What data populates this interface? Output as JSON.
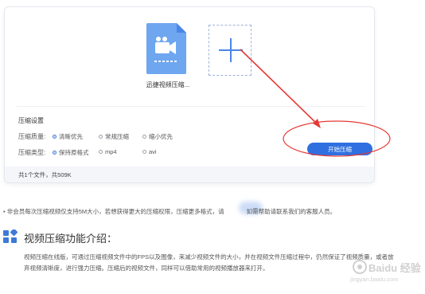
{
  "upload": {
    "file_name": "迅捷视频压缩...",
    "file_icon": "video-file-icon",
    "add_icon": "plus-icon"
  },
  "settings": {
    "title": "压缩设置",
    "quality": {
      "label": "压缩质量:",
      "options": [
        "清晰优先",
        "常规压缩",
        "缩小优先"
      ],
      "selected": "清晰优先"
    },
    "format": {
      "label": "压缩类型:",
      "options": [
        "保持原格式",
        "mp4",
        "avi"
      ],
      "selected": "保持原格式"
    }
  },
  "start_button": {
    "label": "开始压缩"
  },
  "footer": {
    "summary": "共1个文件，共509K"
  },
  "notice": {
    "text": "• 非会员每次压缩视频仅支持5M大小，若想获得更大的压缩权限，压缩更多格式，请",
    "text_after": "如需帮助请联系我们的客服人员。"
  },
  "intro": {
    "icon": "app-grid-icon",
    "title": "视频压缩功能介绍：",
    "text": "视频压缩在线版，可通过压缩视频文件中的FPS以及图像，来减少视频文件的大小，并在视频文件压缩过程中，仍然保证了视频质量，或者放弃视频清晰度，进行强力压缩。压缩后的视频文件，同样可以借助常用的视频播放器来打开。"
  },
  "watermark": {
    "text": "Baidu 经验",
    "url": "jingyan.baidu.com"
  },
  "colors": {
    "accent": "#2f6fe0",
    "annotation_red": "#e53935",
    "icon_blue": "#6ea6f0"
  }
}
